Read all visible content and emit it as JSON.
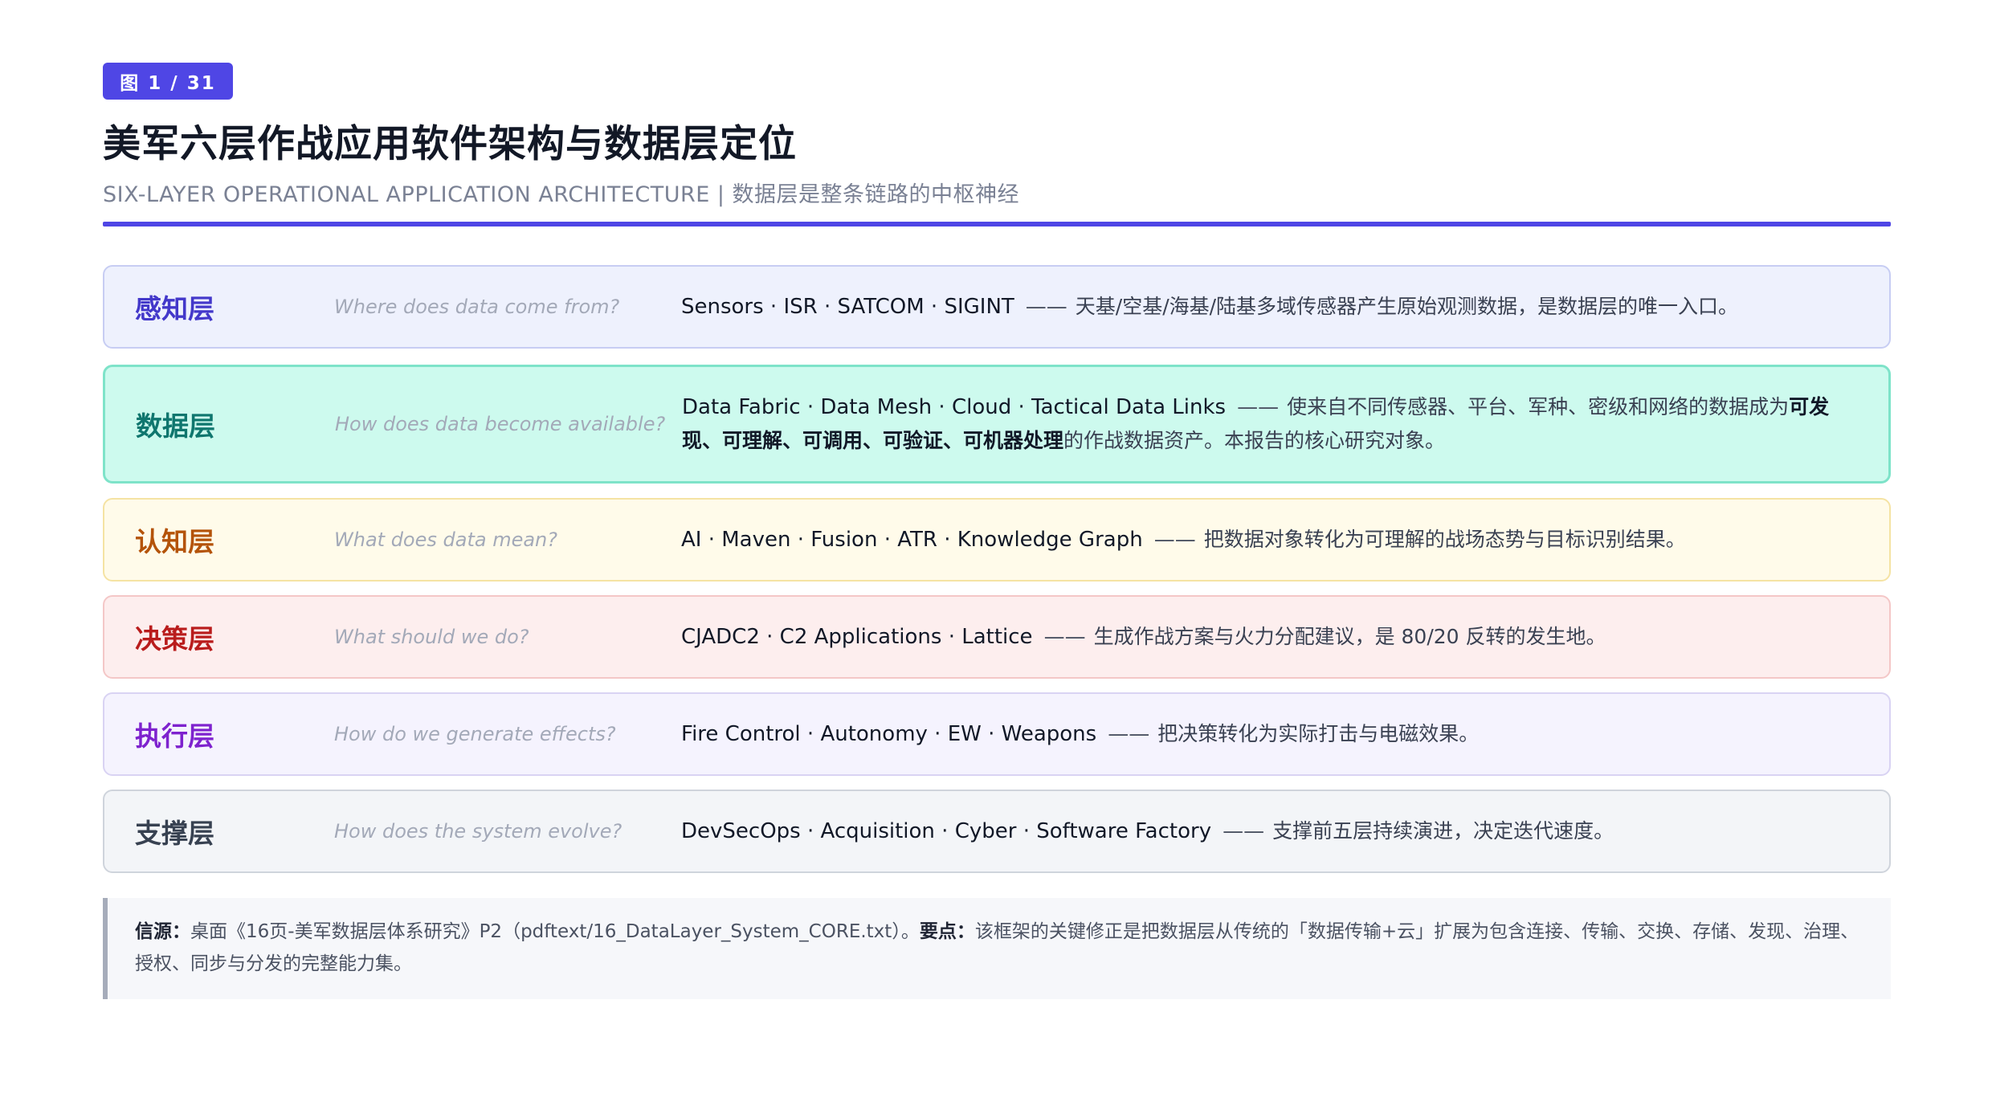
{
  "figure_badge": "图 1 / 31",
  "title": "美军六层作战应用软件架构与数据层定位",
  "subtitle": "SIX-LAYER OPERATIONAL APPLICATION ARCHITECTURE | 数据层是整条链路的中枢神经",
  "colors": {
    "accent": "#4f46e5"
  },
  "layers": [
    {
      "name": "感知层",
      "question": "Where does data come from?",
      "tech": "Sensors · ISR · SATCOM · SIGINT",
      "dash": "——",
      "desc": "天基/空基/海基/陆基多域传感器产生原始观测数据，是数据层的唯一入口。",
      "name_color": "#4338ca",
      "bg": "#eef1fd",
      "border": "#c7cdf3"
    },
    {
      "name": "数据层",
      "question": "How does data become available?",
      "tech": "Data Fabric · Data Mesh · Cloud · Tactical Data Links",
      "dash": "——",
      "desc_a": "使来自不同传感器、平台、军种、密级和网络的数据成为",
      "desc_b1": "可发现、可理解、可调用、可验证、可机器处理",
      "desc_c": "的作战数据资产。本报告的核心研究对象。",
      "name_color": "#0f766e",
      "bg": "#cdfaee",
      "border": "#7ee3c9"
    },
    {
      "name": "认知层",
      "question": "What does data mean?",
      "tech": "AI · Maven · Fusion · ATR · Knowledge Graph",
      "dash": "——",
      "desc": "把数据对象转化为可理解的战场态势与目标识别结果。",
      "name_color": "#b45309",
      "bg": "#fffbea",
      "border": "#f5e3a3"
    },
    {
      "name": "决策层",
      "question": "What should we do?",
      "tech": "CJADC2 · C2 Applications · Lattice",
      "dash": "——",
      "desc": "生成作战方案与火力分配建议，是 80/20 反转的发生地。",
      "name_color": "#b91c1c",
      "bg": "#fdeeee",
      "border": "#f4c7c7"
    },
    {
      "name": "执行层",
      "question": "How do we generate effects?",
      "tech": "Fire Control · Autonomy · EW · Weapons",
      "dash": "——",
      "desc": "把决策转化为实际打击与电磁效果。",
      "name_color": "#7e22ce",
      "bg": "#f5f3fe",
      "border": "#d9d3f3"
    },
    {
      "name": "支撑层",
      "question": "How does the system evolve?",
      "tech": "DevSecOps · Acquisition · Cyber · Software Factory",
      "dash": "——",
      "desc": "支撑前五层持续演进，决定迭代速度。",
      "name_color": "#374151",
      "bg": "#f3f5f8",
      "border": "#cfd4dc"
    }
  ],
  "note": {
    "source_label": "信源：",
    "source_text": "桌面《16页-美军数据层体系研究》P2（pdftext/16_DataLayer_System_CORE.txt）。",
    "key_label": "要点：",
    "key_text": "该框架的关键修正是把数据层从传统的「数据传输+云」扩展为包含连接、传输、交换、存储、发现、治理、授权、同步与分发的完整能力集。"
  }
}
